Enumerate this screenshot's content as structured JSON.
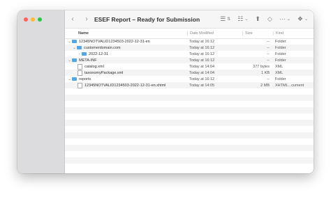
{
  "window": {
    "title": "ESEF Report – Ready for Submission"
  },
  "toolbar": {
    "back_icon": "chevron-left",
    "forward_icon": "chevron-right",
    "list_view_icon": "list",
    "grid_view_icon": "grid",
    "share_icon": "share",
    "tag_icon": "tag",
    "more_icon": "ellipsis-circle",
    "dropbox_icon": "dropbox"
  },
  "columns": {
    "name": "Name",
    "date": "Date Modified",
    "size": "Size",
    "kind": "Kind"
  },
  "rows": [
    {
      "name": "12345NOTVALID1234503-2022-12-31-en",
      "date": "Today at 16:12",
      "size": "--",
      "kind": "Folder"
    },
    {
      "name": "customerdomain.com",
      "date": "Today at 16:12",
      "size": "--",
      "kind": "Folder"
    },
    {
      "name": "2022-12-31",
      "date": "Today at 16:12",
      "size": "--",
      "kind": "Folder"
    },
    {
      "name": "META-INF",
      "date": "Today at 16:12",
      "size": "--",
      "kind": "Folder"
    },
    {
      "name": "catalog.xml",
      "date": "Today at 14:04",
      "size": "377 bytes",
      "kind": "XML"
    },
    {
      "name": "taxonomyPackage.xml",
      "date": "Today at 14:04",
      "size": "1 KB",
      "kind": "XML"
    },
    {
      "name": "reports",
      "date": "Today at 16:12",
      "size": "--",
      "kind": "Folder"
    },
    {
      "name": "12345NOTVALID1234503-2022-12-31-en.xhtml",
      "date": "Today at 14:05",
      "size": "2 MB",
      "kind": "XHTML...cument"
    }
  ]
}
